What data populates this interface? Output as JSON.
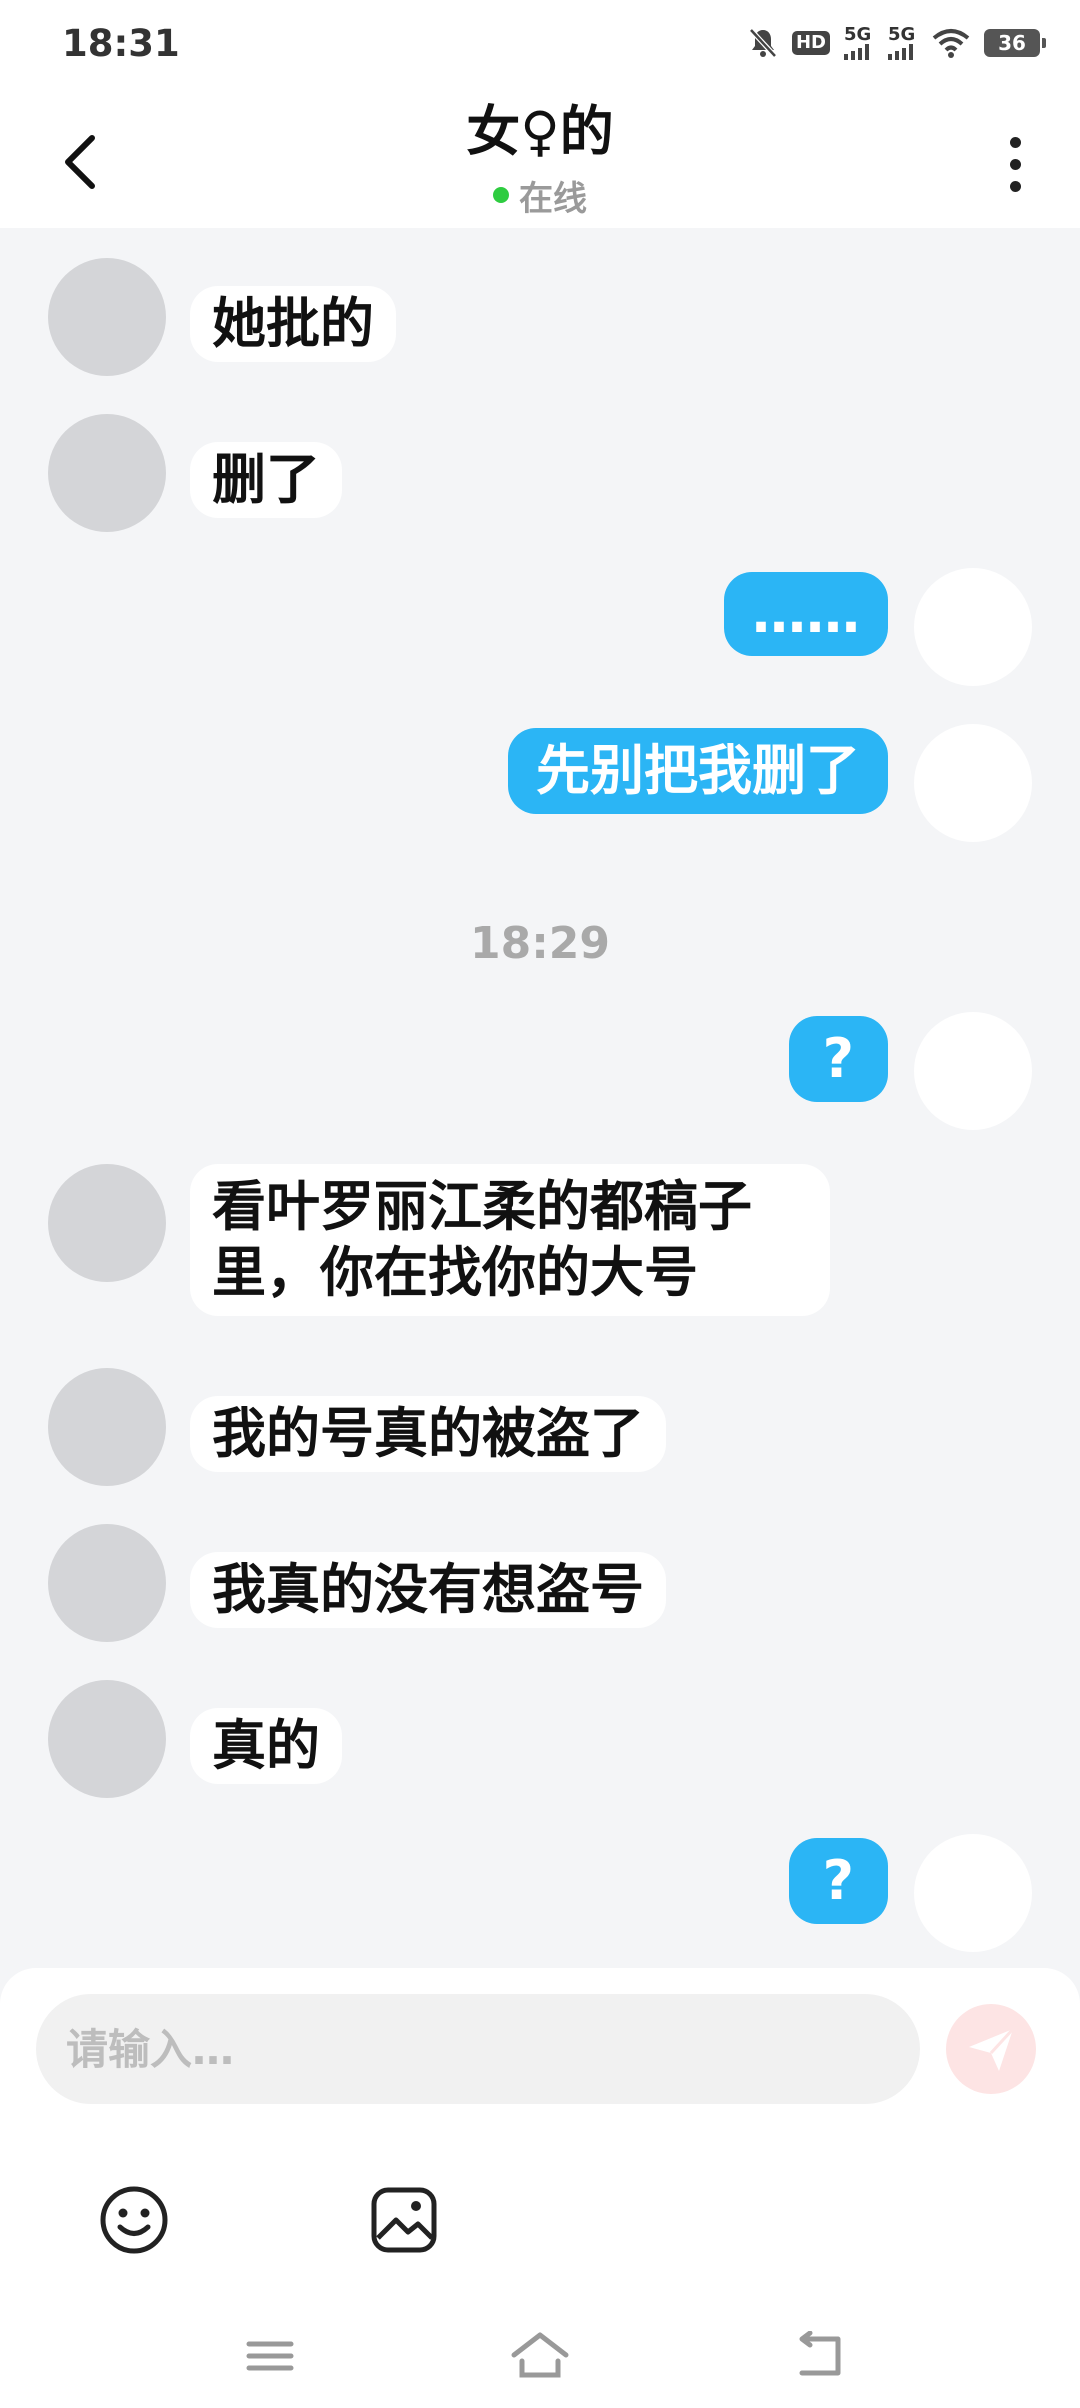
{
  "status_bar": {
    "time": "18:31",
    "hd_label": "HD",
    "sim1_label": "5G",
    "sim2_label": "5G",
    "battery": "36"
  },
  "header": {
    "title": "女♀的",
    "presence": "在线"
  },
  "messages": [
    {
      "side": "left",
      "text": "她批的"
    },
    {
      "side": "left",
      "text": "删了"
    },
    {
      "side": "right",
      "text": "……"
    },
    {
      "side": "right",
      "text": "先别把我删了"
    },
    {
      "side": "right",
      "text": "?"
    },
    {
      "side": "left",
      "text": "看叶罗丽江柔的都稿子里，你在找你的大号"
    },
    {
      "side": "left",
      "text": "我的号真的被盗了"
    },
    {
      "side": "left",
      "text": "我真的没有想盗号"
    },
    {
      "side": "left",
      "text": "真的"
    },
    {
      "side": "right",
      "text": "?"
    }
  ],
  "timestamp": "18:29",
  "composer": {
    "placeholder": "请输入…"
  },
  "colors": {
    "outgoing_bubble": "#2bb5f5",
    "incoming_bubble": "#ffffff",
    "background": "#f4f5f7",
    "online_dot": "#2ecc40",
    "send_button": "#fde4e4"
  },
  "icons": {
    "back": "chevron-left-icon",
    "more": "more-vertical-icon",
    "emoji": "smiley-icon",
    "image": "image-icon",
    "send": "paper-plane-icon",
    "nav_menu": "menu-icon",
    "nav_home": "home-icon",
    "nav_back": "back-icon"
  }
}
